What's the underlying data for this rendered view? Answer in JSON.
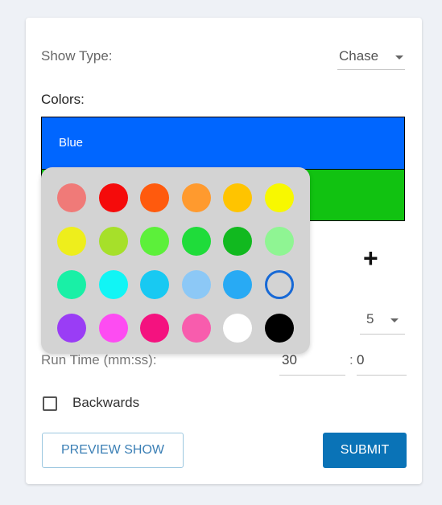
{
  "form": {
    "show_type_label": "Show Type:",
    "show_type_value": "Chase",
    "colors_label": "Colors:",
    "colors": [
      {
        "label": "Blue",
        "color": "#0066ff"
      },
      {
        "label": "",
        "color": "#11c211"
      }
    ],
    "add_color_label": "+",
    "count_value": "5",
    "run_time_label": "Run Time (mm:ss):",
    "run_time_minutes": "30",
    "run_time_separator": ":",
    "run_time_seconds": "0",
    "backwards_label": "Backwards",
    "backwards_checked": false,
    "preview_label": "PREVIEW SHOW",
    "submit_label": "SUBMIT"
  },
  "palette": {
    "rows": [
      [
        "#f07a78",
        "#f50b0b",
        "#ff5a0d",
        "#ff9a2e",
        "#ffc400",
        "#f8f800"
      ],
      [
        "#eeee1c",
        "#a6e02a",
        "#5cf03a",
        "#1fdc3a",
        "#11b91f",
        "#8ff593"
      ],
      [
        "#19f0a6",
        "#11f5f5",
        "#18c9f2",
        "#8cc8f6",
        "#28aaf4",
        "outline"
      ],
      [
        "#9a3df5",
        "#fd4cf2",
        "#f4127f",
        "#f85cad",
        "#ffffff",
        "#000000"
      ]
    ],
    "selected_outline_color": "#1769d6"
  }
}
